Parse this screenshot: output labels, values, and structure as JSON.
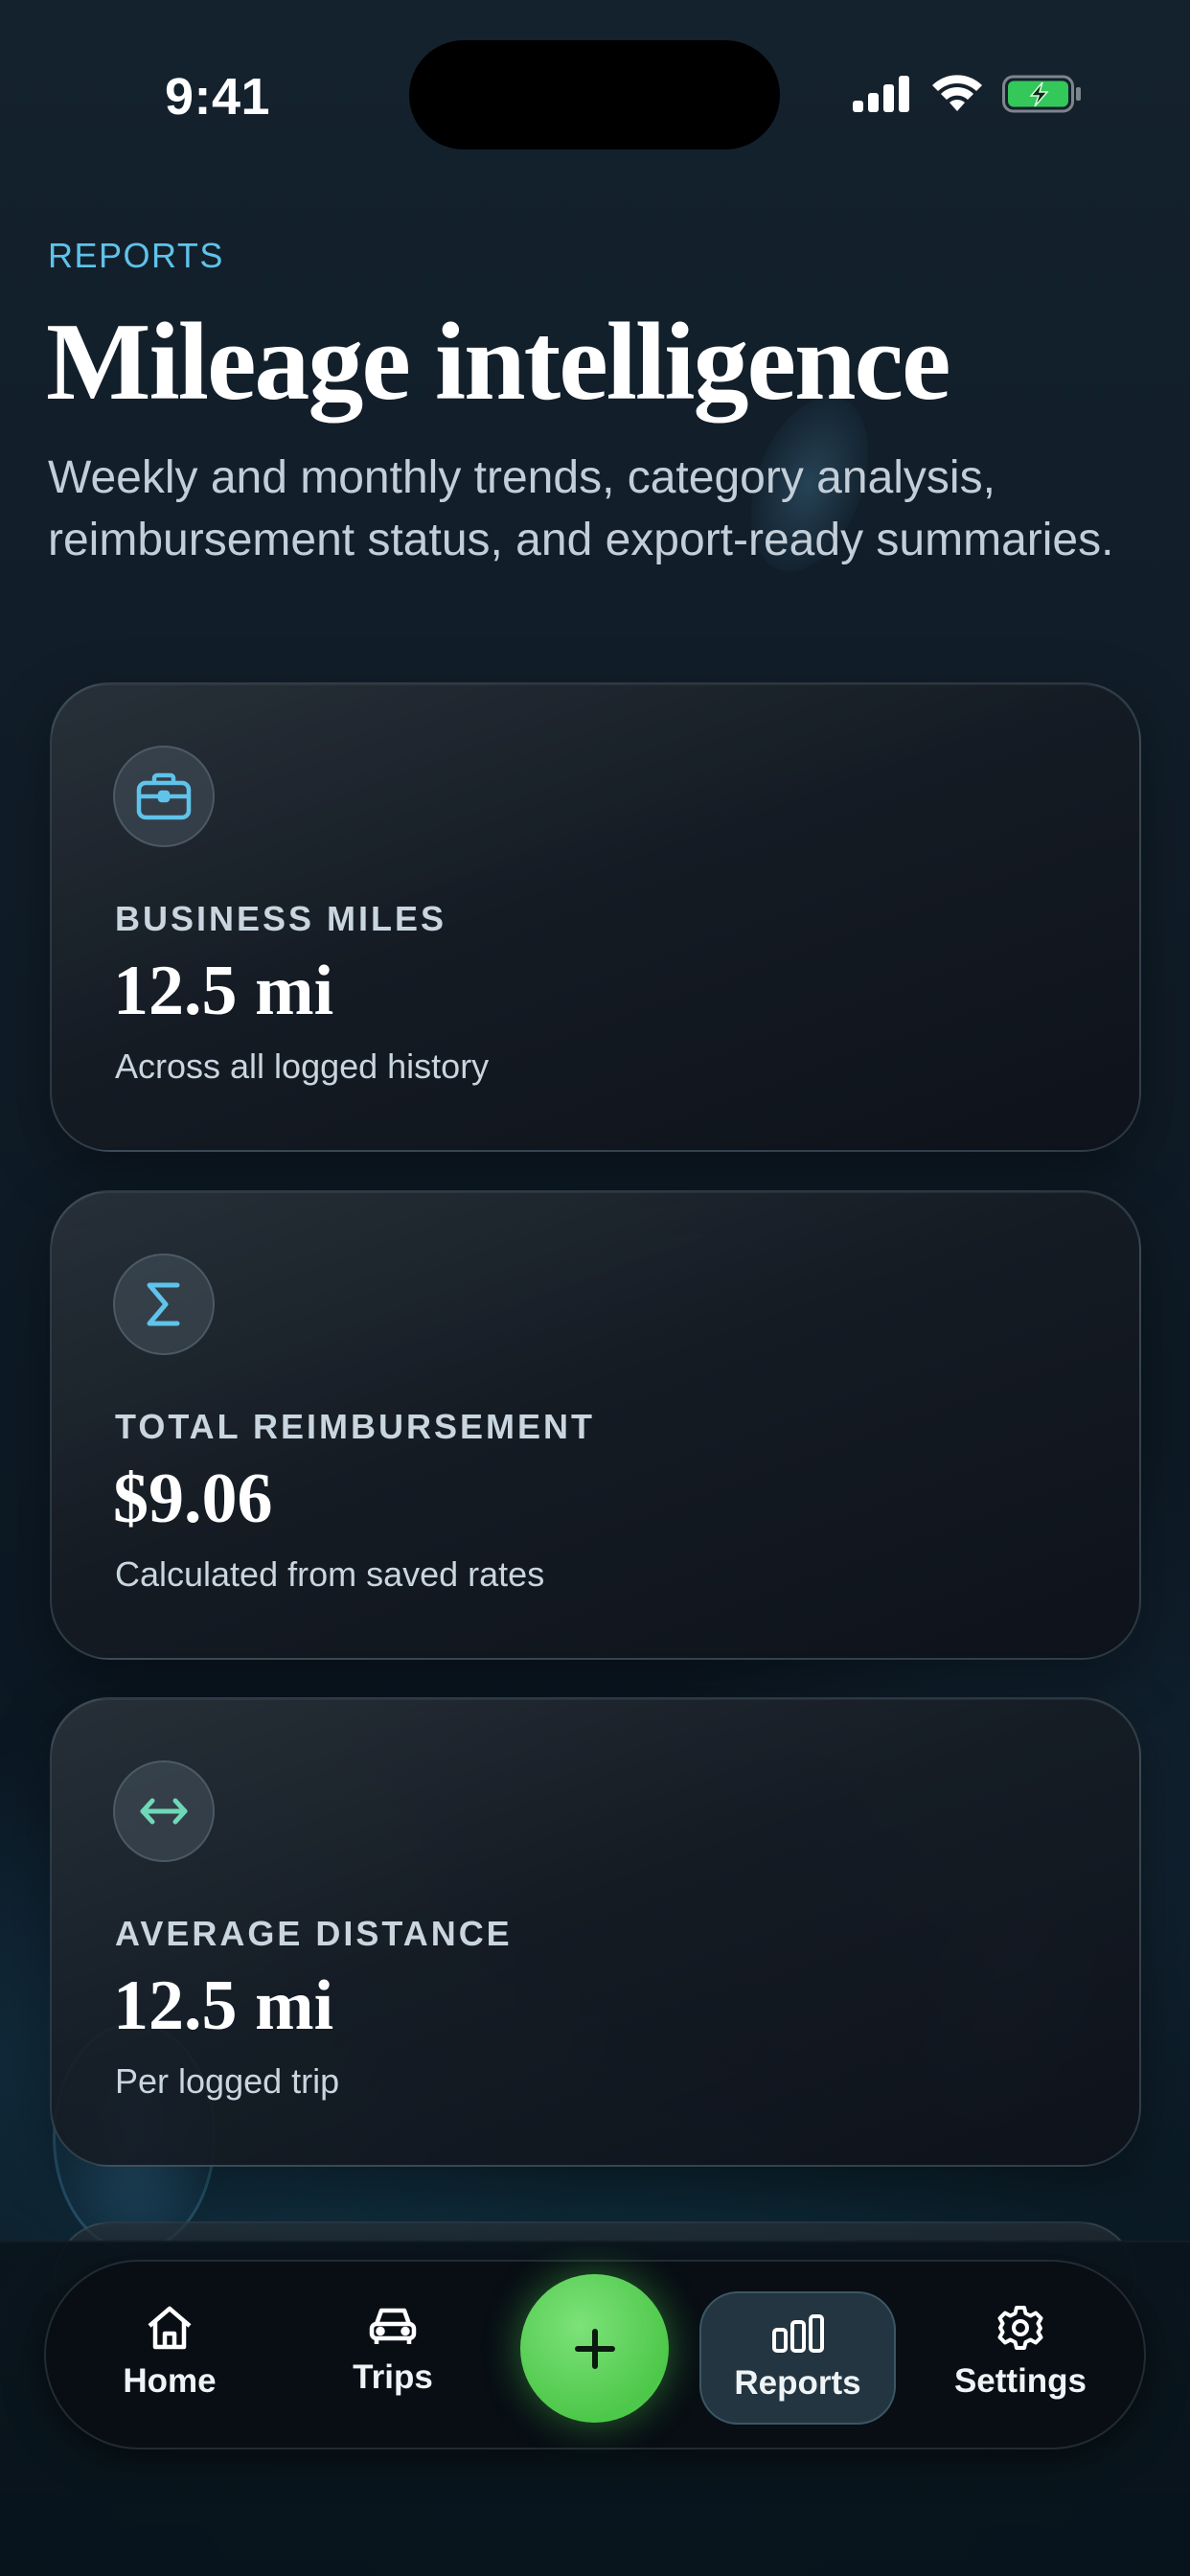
{
  "status_bar": {
    "time": "9:41",
    "icons": [
      "cellular-signal-icon",
      "wifi-icon",
      "battery-charging-icon"
    ],
    "battery_color": "#34c759"
  },
  "header": {
    "eyebrow": "REPORTS",
    "title": "Mileage intelligence",
    "subtitle": "Weekly and monthly trends, category analysis, reimbursement status, and export-ready summaries."
  },
  "cards": [
    {
      "icon": "briefcase-icon",
      "label": "BUSINESS MILES",
      "value": "12.5 mi",
      "caption": "Across all logged history"
    },
    {
      "icon": "sigma-icon",
      "label": "TOTAL REIMBURSEMENT",
      "value": "$9.06",
      "caption": "Calculated from saved rates"
    },
    {
      "icon": "arrows-horizontal-icon",
      "label": "AVERAGE DISTANCE",
      "value": "12.5 mi",
      "caption": "Per logged trip"
    }
  ],
  "tab_bar": {
    "items": [
      {
        "label": "Home",
        "icon": "home-icon",
        "active": false
      },
      {
        "label": "Trips",
        "icon": "car-icon",
        "active": false
      },
      {
        "label": "Reports",
        "icon": "bar-chart-icon",
        "active": true
      },
      {
        "label": "Settings",
        "icon": "gear-icon",
        "active": false
      }
    ],
    "add_button_icon": "plus-icon"
  },
  "colors": {
    "accent": "#5fc3ea",
    "add_button": "#5ed25a",
    "background": "#0f1b26"
  }
}
